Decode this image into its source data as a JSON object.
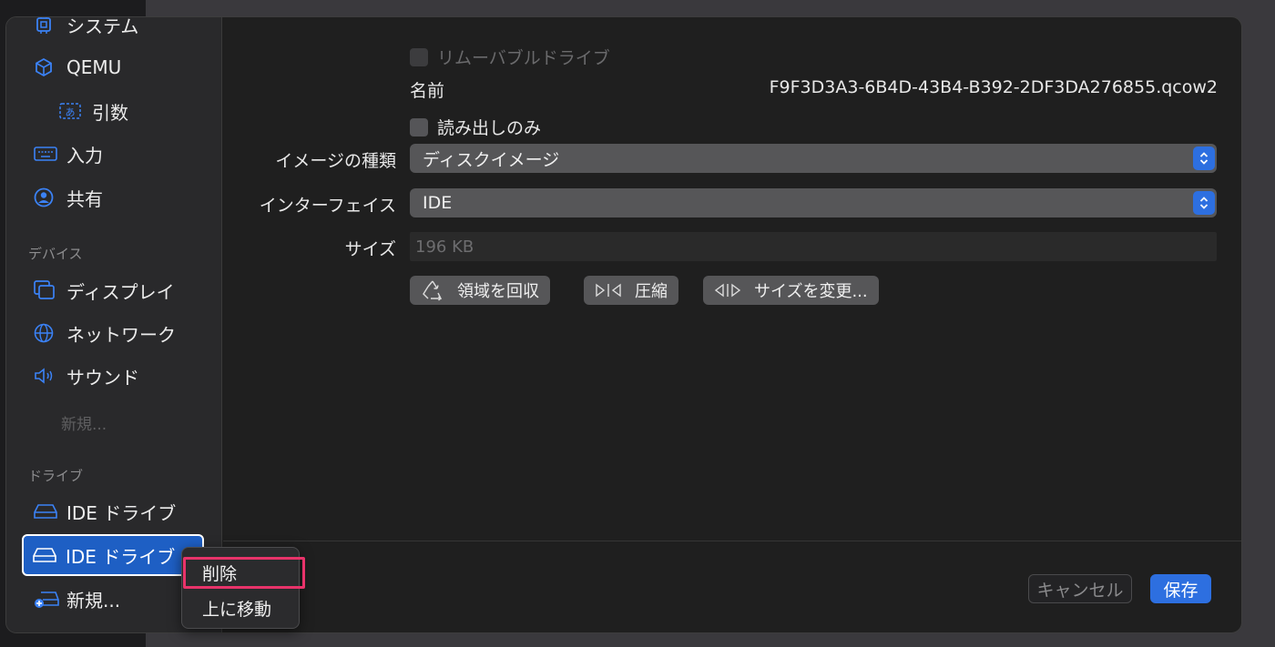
{
  "sidebar": {
    "items": [
      {
        "label": "システム",
        "icon": "cpu-icon"
      },
      {
        "label": "QEMU",
        "icon": "cube-icon"
      },
      {
        "label": "引数",
        "icon": "text-input-icon"
      },
      {
        "label": "入力",
        "icon": "keyboard-icon"
      },
      {
        "label": "共有",
        "icon": "person-circle-icon"
      }
    ],
    "devices_header": "デバイス",
    "devices": [
      {
        "label": "ディスプレイ",
        "icon": "display-icon"
      },
      {
        "label": "ネットワーク",
        "icon": "network-globe-icon"
      },
      {
        "label": "サウンド",
        "icon": "speaker-icon"
      }
    ],
    "devices_new": "新規...",
    "drives_header": "ドライブ",
    "drives": [
      {
        "label": "IDE ドライブ",
        "icon": "drive-icon"
      },
      {
        "label": "IDE ドライブ",
        "icon": "drive-icon",
        "selected": true
      }
    ],
    "drives_new": "新規...",
    "drives_new_icon": "drive-add-icon"
  },
  "main": {
    "removable_label": "リムーバブルドライブ",
    "name_label": "名前",
    "name_value": "F9F3D3A3-6B4D-43B4-B392-2DF3DA276855.qcow2",
    "readonly_label": "読み出しのみ",
    "image_type_label": "イメージの種類",
    "image_type_value": "ディスクイメージ",
    "interface_label": "インターフェイス",
    "interface_value": "IDE",
    "size_label": "サイズ",
    "size_value": "196 KB",
    "reclaim_label": "領域を回収",
    "compress_label": "圧縮",
    "resize_label": "サイズを変更..."
  },
  "footer": {
    "cancel_label": "キャンセル",
    "save_label": "保存"
  },
  "context_menu": {
    "delete_label": "削除",
    "move_up_label": "上に移動"
  },
  "colors": {
    "accent": "#2d6fe0",
    "highlight": "#e8336a"
  }
}
